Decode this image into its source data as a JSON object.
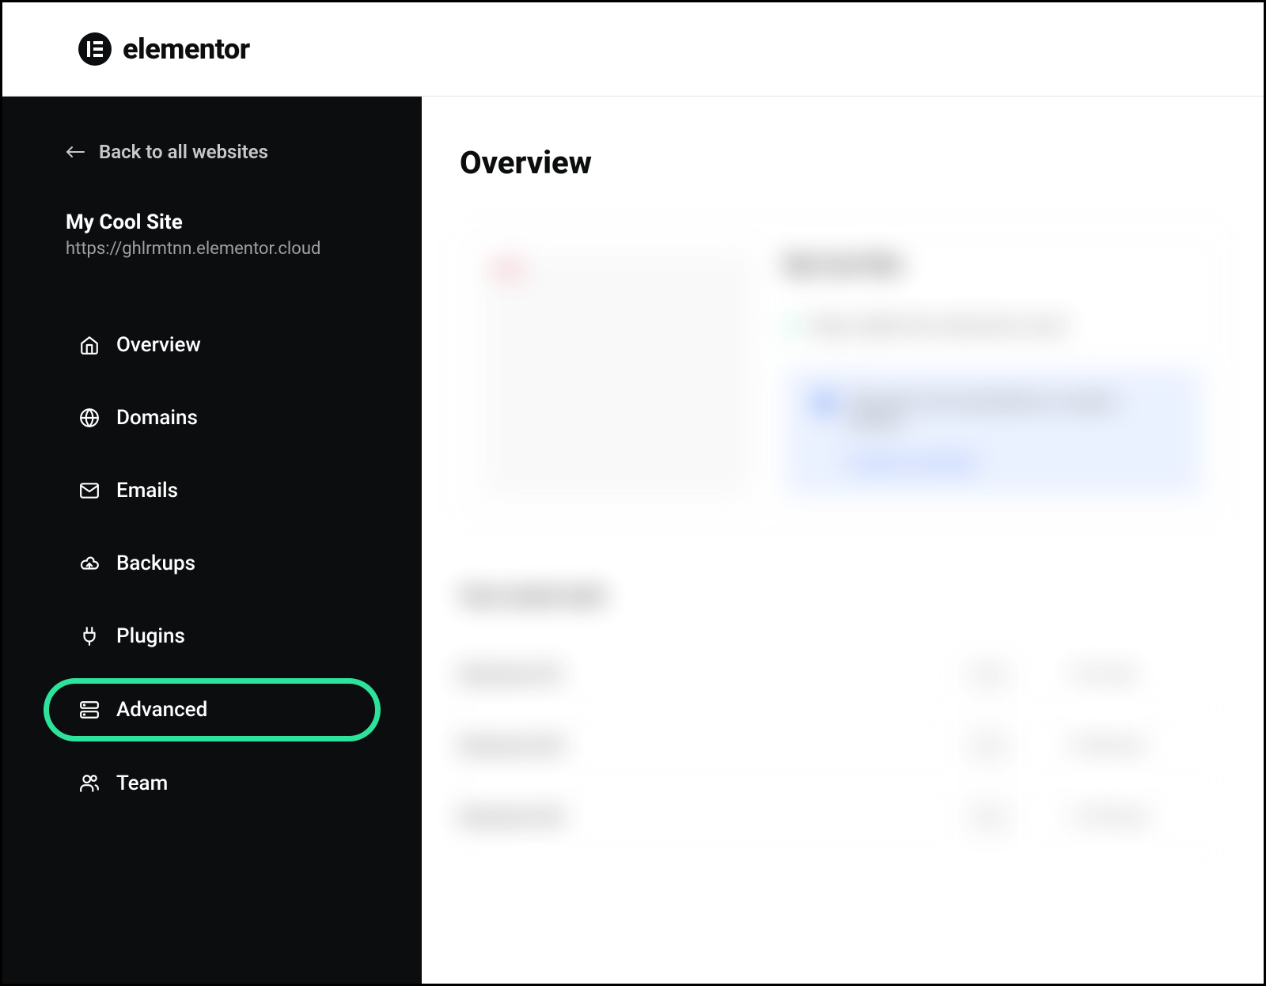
{
  "header": {
    "brand": "elementor"
  },
  "sidebar": {
    "back_label": "Back to all websites",
    "site_name": "My Cool Site",
    "site_url": "https://ghlrmtnn.elementor.cloud",
    "nav": [
      {
        "icon": "home-icon",
        "label": "Overview",
        "highlighted": false
      },
      {
        "icon": "globe-icon",
        "label": "Domains",
        "highlighted": false
      },
      {
        "icon": "mail-icon",
        "label": "Emails",
        "highlighted": false
      },
      {
        "icon": "cloud-icon",
        "label": "Backups",
        "highlighted": false
      },
      {
        "icon": "plug-icon",
        "label": "Plugins",
        "highlighted": false
      },
      {
        "icon": "server-icon",
        "label": "Advanced",
        "highlighted": true
      },
      {
        "icon": "team-icon",
        "label": "Team",
        "highlighted": false
      }
    ]
  },
  "main": {
    "title": "Overview",
    "card": {
      "badge": "LIVE",
      "site_name": "My Cool Site",
      "site_url": "https://ghlrmtnn.elementor.cloud",
      "banner_text": "This site is not connected to a custom domain",
      "banner_link": "Connect a domain"
    },
    "section_title": "Your recent work",
    "rows": [
      {
        "name": "Elementor 001",
        "tag": "Page",
        "time": "1 hour ago"
      },
      {
        "name": "Elementor 002",
        "tag": "Page",
        "time": "10 days ago"
      },
      {
        "name": "Elementor 003",
        "tag": "Page",
        "time": "1 month ago"
      }
    ]
  }
}
